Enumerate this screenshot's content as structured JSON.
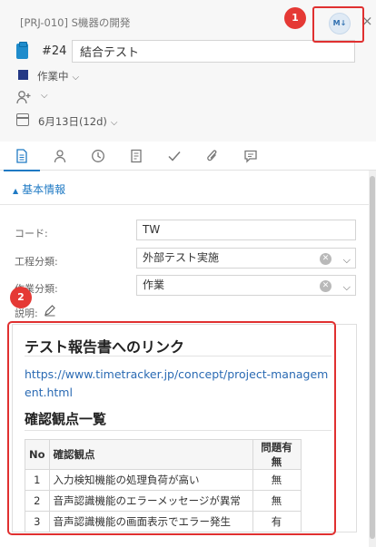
{
  "header": {
    "project": "[PRJ-010] S機器の開発",
    "md_button": "M↓",
    "close_icon": "×",
    "task_number": "#24",
    "task_name": "結合テスト",
    "status": "作業中",
    "status_color": "#243985",
    "date": "6月13日(12d)"
  },
  "callouts": {
    "one": "1",
    "two": "2",
    "color": "#e53935"
  },
  "tabs": [
    {
      "name": "document-icon"
    },
    {
      "name": "person-icon"
    },
    {
      "name": "clock-icon"
    },
    {
      "name": "notes-icon"
    },
    {
      "name": "check-icon"
    },
    {
      "name": "paperclip-icon"
    },
    {
      "name": "comment-icon"
    }
  ],
  "section": {
    "title": "基本情報"
  },
  "fields": {
    "code_label": "コード:",
    "code_value": "TW",
    "process_label": "工程分類:",
    "process_value": "外部テスト実施",
    "work_label": "作業分類:",
    "work_value": "作業",
    "desc_label": "説明:"
  },
  "description": {
    "heading_link": "テスト報告書へのリンク",
    "url": "https://www.timetracker.jp/concept/project-management.html",
    "heading_check": "確認観点一覧",
    "table": {
      "headers": [
        "No",
        "確認観点",
        "問題有無"
      ],
      "rows": [
        [
          "1",
          "入力検知機能の処理負荷が高い",
          "無"
        ],
        [
          "2",
          "音声認識機能のエラーメッセージが異常",
          "無"
        ],
        [
          "3",
          "音声認識機能の画面表示でエラー発生",
          "有"
        ]
      ]
    }
  },
  "accent_color": "#1f7ac4"
}
